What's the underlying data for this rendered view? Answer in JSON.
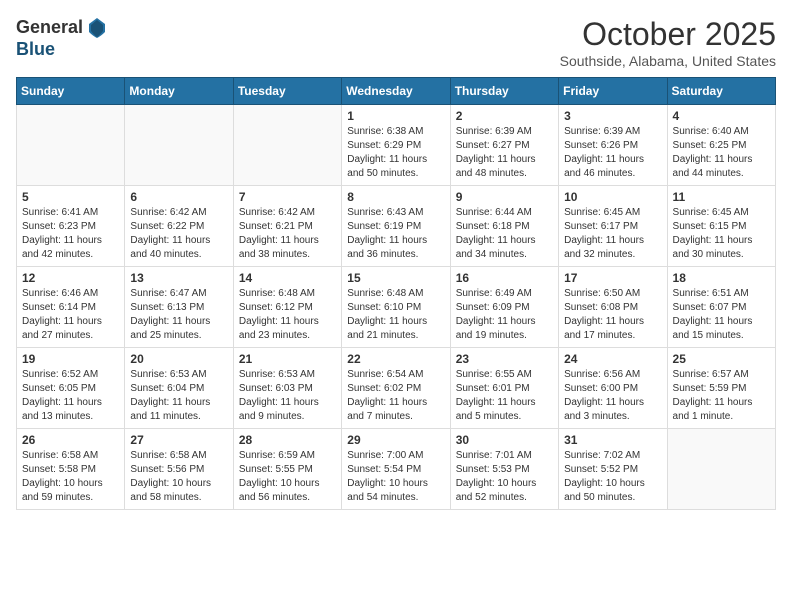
{
  "logo": {
    "general": "General",
    "blue": "Blue"
  },
  "title": "October 2025",
  "location": "Southside, Alabama, United States",
  "days_of_week": [
    "Sunday",
    "Monday",
    "Tuesday",
    "Wednesday",
    "Thursday",
    "Friday",
    "Saturday"
  ],
  "weeks": [
    [
      {
        "day": "",
        "content": ""
      },
      {
        "day": "",
        "content": ""
      },
      {
        "day": "",
        "content": ""
      },
      {
        "day": "1",
        "content": "Sunrise: 6:38 AM\nSunset: 6:29 PM\nDaylight: 11 hours\nand 50 minutes."
      },
      {
        "day": "2",
        "content": "Sunrise: 6:39 AM\nSunset: 6:27 PM\nDaylight: 11 hours\nand 48 minutes."
      },
      {
        "day": "3",
        "content": "Sunrise: 6:39 AM\nSunset: 6:26 PM\nDaylight: 11 hours\nand 46 minutes."
      },
      {
        "day": "4",
        "content": "Sunrise: 6:40 AM\nSunset: 6:25 PM\nDaylight: 11 hours\nand 44 minutes."
      }
    ],
    [
      {
        "day": "5",
        "content": "Sunrise: 6:41 AM\nSunset: 6:23 PM\nDaylight: 11 hours\nand 42 minutes."
      },
      {
        "day": "6",
        "content": "Sunrise: 6:42 AM\nSunset: 6:22 PM\nDaylight: 11 hours\nand 40 minutes."
      },
      {
        "day": "7",
        "content": "Sunrise: 6:42 AM\nSunset: 6:21 PM\nDaylight: 11 hours\nand 38 minutes."
      },
      {
        "day": "8",
        "content": "Sunrise: 6:43 AM\nSunset: 6:19 PM\nDaylight: 11 hours\nand 36 minutes."
      },
      {
        "day": "9",
        "content": "Sunrise: 6:44 AM\nSunset: 6:18 PM\nDaylight: 11 hours\nand 34 minutes."
      },
      {
        "day": "10",
        "content": "Sunrise: 6:45 AM\nSunset: 6:17 PM\nDaylight: 11 hours\nand 32 minutes."
      },
      {
        "day": "11",
        "content": "Sunrise: 6:45 AM\nSunset: 6:15 PM\nDaylight: 11 hours\nand 30 minutes."
      }
    ],
    [
      {
        "day": "12",
        "content": "Sunrise: 6:46 AM\nSunset: 6:14 PM\nDaylight: 11 hours\nand 27 minutes."
      },
      {
        "day": "13",
        "content": "Sunrise: 6:47 AM\nSunset: 6:13 PM\nDaylight: 11 hours\nand 25 minutes."
      },
      {
        "day": "14",
        "content": "Sunrise: 6:48 AM\nSunset: 6:12 PM\nDaylight: 11 hours\nand 23 minutes."
      },
      {
        "day": "15",
        "content": "Sunrise: 6:48 AM\nSunset: 6:10 PM\nDaylight: 11 hours\nand 21 minutes."
      },
      {
        "day": "16",
        "content": "Sunrise: 6:49 AM\nSunset: 6:09 PM\nDaylight: 11 hours\nand 19 minutes."
      },
      {
        "day": "17",
        "content": "Sunrise: 6:50 AM\nSunset: 6:08 PM\nDaylight: 11 hours\nand 17 minutes."
      },
      {
        "day": "18",
        "content": "Sunrise: 6:51 AM\nSunset: 6:07 PM\nDaylight: 11 hours\nand 15 minutes."
      }
    ],
    [
      {
        "day": "19",
        "content": "Sunrise: 6:52 AM\nSunset: 6:05 PM\nDaylight: 11 hours\nand 13 minutes."
      },
      {
        "day": "20",
        "content": "Sunrise: 6:53 AM\nSunset: 6:04 PM\nDaylight: 11 hours\nand 11 minutes."
      },
      {
        "day": "21",
        "content": "Sunrise: 6:53 AM\nSunset: 6:03 PM\nDaylight: 11 hours\nand 9 minutes."
      },
      {
        "day": "22",
        "content": "Sunrise: 6:54 AM\nSunset: 6:02 PM\nDaylight: 11 hours\nand 7 minutes."
      },
      {
        "day": "23",
        "content": "Sunrise: 6:55 AM\nSunset: 6:01 PM\nDaylight: 11 hours\nand 5 minutes."
      },
      {
        "day": "24",
        "content": "Sunrise: 6:56 AM\nSunset: 6:00 PM\nDaylight: 11 hours\nand 3 minutes."
      },
      {
        "day": "25",
        "content": "Sunrise: 6:57 AM\nSunset: 5:59 PM\nDaylight: 11 hours\nand 1 minute."
      }
    ],
    [
      {
        "day": "26",
        "content": "Sunrise: 6:58 AM\nSunset: 5:58 PM\nDaylight: 10 hours\nand 59 minutes."
      },
      {
        "day": "27",
        "content": "Sunrise: 6:58 AM\nSunset: 5:56 PM\nDaylight: 10 hours\nand 58 minutes."
      },
      {
        "day": "28",
        "content": "Sunrise: 6:59 AM\nSunset: 5:55 PM\nDaylight: 10 hours\nand 56 minutes."
      },
      {
        "day": "29",
        "content": "Sunrise: 7:00 AM\nSunset: 5:54 PM\nDaylight: 10 hours\nand 54 minutes."
      },
      {
        "day": "30",
        "content": "Sunrise: 7:01 AM\nSunset: 5:53 PM\nDaylight: 10 hours\nand 52 minutes."
      },
      {
        "day": "31",
        "content": "Sunrise: 7:02 AM\nSunset: 5:52 PM\nDaylight: 10 hours\nand 50 minutes."
      },
      {
        "day": "",
        "content": ""
      }
    ]
  ]
}
